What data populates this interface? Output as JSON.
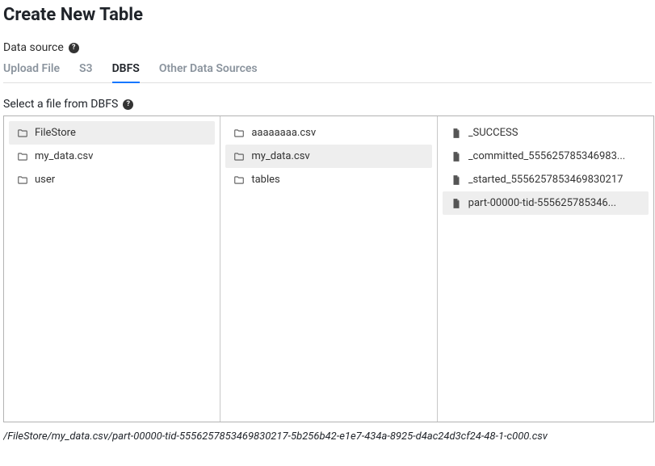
{
  "page": {
    "title": "Create New Table"
  },
  "dataSource": {
    "label": "Data source"
  },
  "tabs": {
    "uploadFile": "Upload File",
    "s3": "S3",
    "dbfs": "DBFS",
    "other": "Other Data Sources",
    "active": "dbfs"
  },
  "prompt": "Select a file from DBFS",
  "browser": {
    "col1": [
      {
        "name": "FileStore",
        "type": "folder",
        "selected": true
      },
      {
        "name": "my_data.csv",
        "type": "folder",
        "selected": false
      },
      {
        "name": "user",
        "type": "folder",
        "selected": false
      }
    ],
    "col2": [
      {
        "name": "aaaaaaaa.csv",
        "type": "folder",
        "selected": false
      },
      {
        "name": "my_data.csv",
        "type": "folder",
        "selected": true
      },
      {
        "name": "tables",
        "type": "folder",
        "selected": false
      }
    ],
    "col3": [
      {
        "name": "_SUCCESS",
        "type": "file",
        "selected": false
      },
      {
        "name": "_committed_555625785346983...",
        "type": "file",
        "selected": false
      },
      {
        "name": "_started_5556257853469830217",
        "type": "file",
        "selected": false
      },
      {
        "name": "part-00000-tid-555625785346...",
        "type": "file",
        "selected": true
      }
    ]
  },
  "selectedPath": "/FileStore/my_data.csv/part-00000-tid-5556257853469830217-5b256b42-e1e7-434a-8925-d4ac24d3cf24-48-1-c000.csv"
}
